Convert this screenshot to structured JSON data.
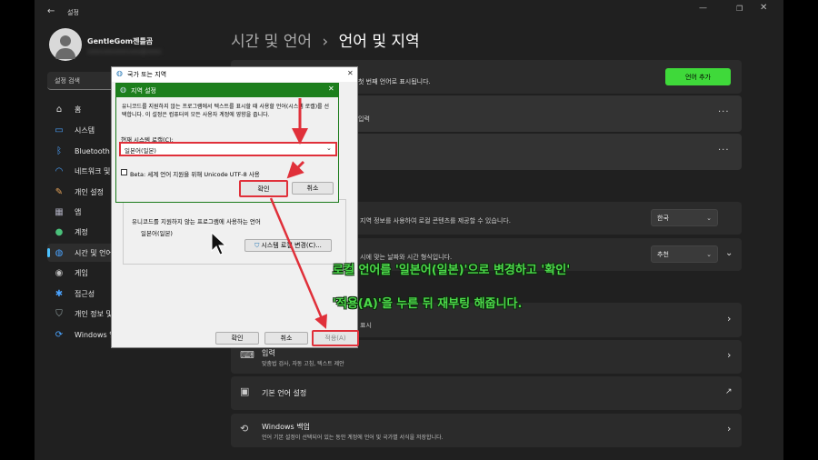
{
  "window": {
    "title": "설정"
  },
  "user": {
    "name": "GentleGom젠틀곰",
    "email_blurred": "xxxxxxxxxxxxxx@xxxx"
  },
  "search": {
    "placeholder": "설정 검색"
  },
  "sidebar": {
    "items": [
      {
        "label": "홈",
        "icon": "home-icon"
      },
      {
        "label": "시스템",
        "icon": "monitor-icon"
      },
      {
        "label": "Bluetooth 및 장치",
        "icon": "bluetooth-icon"
      },
      {
        "label": "네트워크 및 인터넷",
        "icon": "wifi-icon"
      },
      {
        "label": "개인 설정",
        "icon": "brush-icon"
      },
      {
        "label": "앱",
        "icon": "apps-icon"
      },
      {
        "label": "계정",
        "icon": "account-icon"
      },
      {
        "label": "시간 및 언어",
        "icon": "globe-clock-icon"
      },
      {
        "label": "게임",
        "icon": "gamepad-icon"
      },
      {
        "label": "접근성",
        "icon": "accessibility-icon"
      },
      {
        "label": "개인 정보 및 보안",
        "icon": "shield-icon"
      },
      {
        "label": "Windows 업데이트",
        "icon": "update-icon"
      }
    ]
  },
  "breadcrumb": {
    "parent": "시간 및 언어",
    "separator": "›",
    "current": "언어 및 지역"
  },
  "main": {
    "language_row_text": "첫 번째 언어로 표시됩니다.",
    "add_language_button": "언어 추가",
    "row2_text": "입력",
    "country_desc": "지역 정보를 사용하여 로컬 콘텐츠를 제공할 수 있습니다.",
    "country_value": "한국",
    "format_desc": "시에 맞는 날짜와 시간 형식입니다.",
    "format_value": "추천",
    "related_row1": "표시",
    "input_title": "입력",
    "input_desc": "맞춤법 검사, 자동 고침, 텍스트 제안",
    "admin_title": "기본 언어 설정",
    "backup_title": "Windows 백업",
    "backup_desc": "언어 기본 설정이 선택되어 있는 동안 계정에 언어 및 국가별 서식을 저장합니다."
  },
  "region_dialog": {
    "title": "국가 또는 지역",
    "section_text": "유니코드를 지원하지 않는 프로그램에 사용하는 언어",
    "current_locale": "일본어(일본)",
    "change_locale_button": "시스템 로캘 변경(C)...",
    "ok": "확인",
    "cancel": "취소",
    "apply": "적용(A)"
  },
  "locale_dialog": {
    "title": "지역 설정",
    "description": "유니코드를 지원하지 않는 프로그램에서 텍스트를 표시할 때 사용할 언어(시스템 로캘)를 선택합니다. 이 설정은 컴퓨터의 모든 사용자 계정에 영향을 줍니다.",
    "label": "현재 시스템 로캘(C):",
    "selected": "일본어(일본)",
    "beta_checkbox": "Beta: 세계 언어 지원을 위해 Unicode UTF-8 사용",
    "ok": "확인",
    "cancel": "취소"
  },
  "captions": {
    "line1": "로컬 언어를 '일본어(일본)'으로 변경하고 '확인'",
    "line2": "'적용(A)'을 누른 뒤 재부팅 해줍니다."
  },
  "colors": {
    "accent_green": "#4cd84a",
    "highlight_red": "#e0303a",
    "add_button": "#3fd93a"
  }
}
